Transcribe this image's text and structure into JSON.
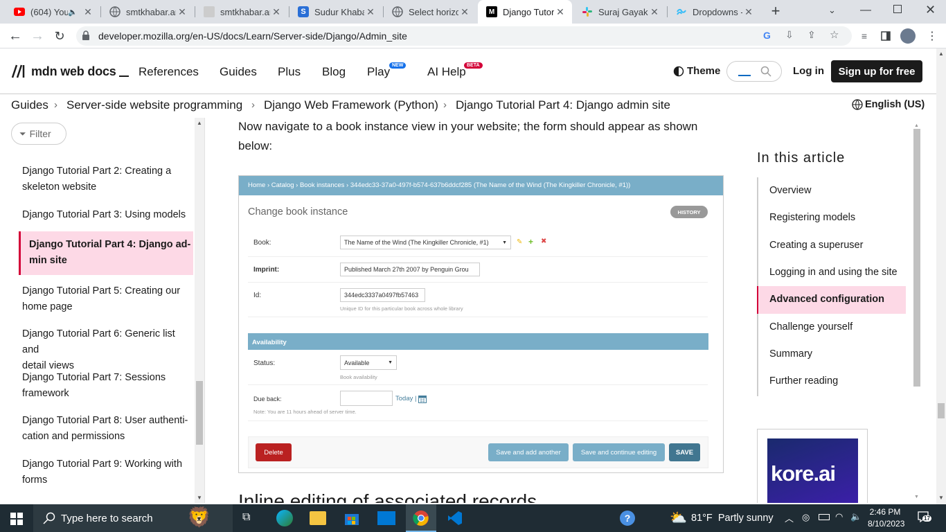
{
  "browser": {
    "tabs": [
      {
        "title": "(604) You",
        "icon": "youtube-icon"
      },
      {
        "title": "smtkhabar.an",
        "icon": "globe-icon"
      },
      {
        "title": "smtkhabar.an",
        "icon": "site-icon"
      },
      {
        "title": "Sudur Khabar",
        "icon": "site-icon"
      },
      {
        "title": "Select horizo",
        "icon": "globe-icon"
      },
      {
        "title": "Django Tutor",
        "icon": "mdn-icon"
      },
      {
        "title": "Suraj Gayak -",
        "icon": "slack-icon"
      },
      {
        "title": "Dropdowns -",
        "icon": "tailwind-icon"
      }
    ],
    "url": "developer.mozilla.org/en-US/docs/Learn/Server-side/Django/Admin_site"
  },
  "mdn": {
    "logo": "mdn web docs",
    "nav": [
      "References",
      "Guides",
      "Plus",
      "Blog",
      "Play",
      "AI Help"
    ],
    "play_badge": "NEW",
    "ai_badge": "BETA",
    "theme": "Theme",
    "login": "Log in",
    "signup": "Sign up for free"
  },
  "breadcrumb": [
    "Guides",
    "Server-side website programming",
    "Django Web Framework (Python)",
    "Django Tutorial Part 4: Django admin site"
  ],
  "language": "English (US)",
  "sidebar": {
    "filter": "Filter",
    "items": [
      {
        "label": "Django Tutorial Part 2: Creating a skeleton website",
        "lines": [
          "Django Tutorial Part 2: Creating a",
          "skeleton website"
        ]
      },
      {
        "label": "Django Tutorial Part 3: Using models",
        "lines": [
          "Django Tutorial Part 3: Using models"
        ]
      },
      {
        "label": "Django Tutorial Part 4: Django admin site",
        "lines": [
          "Django Tutorial Part 4: Django ad-",
          "min site"
        ],
        "active": true
      },
      {
        "label": "Django Tutorial Part 5: Creating our home page",
        "lines": [
          "Django Tutorial Part 5: Creating our",
          "home page"
        ]
      },
      {
        "label": "Django Tutorial Part 6: Generic list and detail views",
        "lines": [
          "Django Tutorial Part 6: Generic list and",
          "detail views"
        ]
      },
      {
        "label": "Django Tutorial Part 7: Sessions framework",
        "lines": [
          "Django Tutorial Part 7: Sessions",
          "framework"
        ]
      },
      {
        "label": "Django Tutorial Part 8: User authentication and permissions",
        "lines": [
          "Django Tutorial Part 8: User authenti-",
          "cation and permissions"
        ]
      },
      {
        "label": "Django Tutorial Part 9: Working with forms",
        "lines": [
          "Django Tutorial Part 9: Working with",
          "forms"
        ]
      }
    ]
  },
  "article": {
    "intro_line1": "Now navigate to a book instance view in your website; the form should appear as shown",
    "intro_line2": "below:",
    "next_heading": "Inline editing of associated records"
  },
  "django": {
    "breadcrumb": "Home › Catalog › Book instances › 344edc33-37a0-497f-b574-637b6ddcf285 (The Name of the Wind (The Kingkiller Chronicle, #1))",
    "title": "Change book instance",
    "history": "HISTORY",
    "book_label": "Book:",
    "book_value": "The Name of the Wind (The Kingkiller Chronicle, #1)",
    "imprint_label": "Imprint:",
    "imprint_value": "Published March 27th 2007 by Penguin Grou",
    "id_label": "Id:",
    "id_value": "344edc3337a0497fb57463",
    "id_help": "Unique ID for this particular book across whole library",
    "section": "Availability",
    "status_label": "Status:",
    "status_value": "Available",
    "status_help": "Book availability",
    "dueback_label": "Due back:",
    "today": "Today |",
    "note": "Note: You are 11 hours ahead of server time.",
    "delete": "Delete",
    "save_add": "Save and add another",
    "save_continue": "Save and continue editing",
    "save": "SAVE"
  },
  "toc": {
    "heading": "In this article",
    "items": [
      "Overview",
      "Registering models",
      "Creating a superuser",
      "Logging in and using the site",
      "Advanced configuration",
      "Challenge yourself",
      "Summary",
      "Further reading"
    ],
    "active": "Advanced configuration"
  },
  "ad": {
    "brand": "kore.ai"
  },
  "taskbar": {
    "search": "Type here to search",
    "weather": "81°F  Partly sunny",
    "time": "2:46 PM",
    "date": "8/10/2023",
    "notifications": "17"
  },
  "colors": {
    "mdn_active_bg": "#fdd9e6",
    "mdn_active_border": "#d30038",
    "django_header": "#79aec8",
    "django_delete": "#ba2121",
    "django_save": "#417690",
    "taskbar": "#1f2c34"
  }
}
